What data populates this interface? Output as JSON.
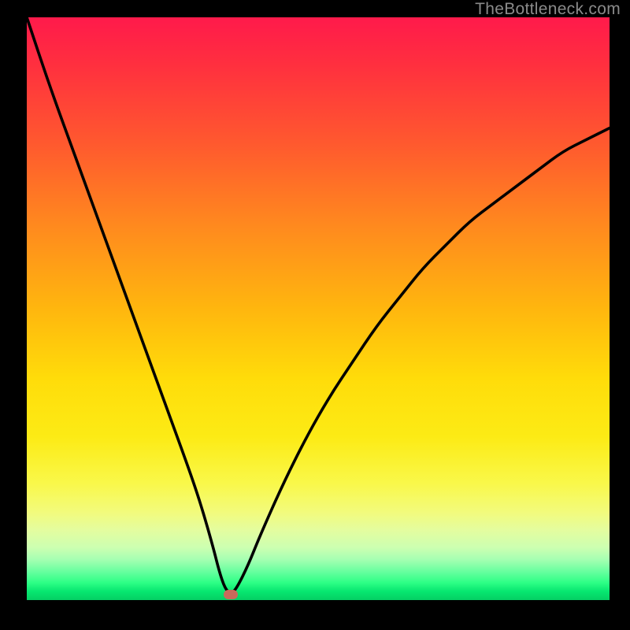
{
  "watermark": "TheBottleneck.com",
  "colors": {
    "curve_stroke": "#000000",
    "marker_fill": "#c96a5b",
    "frame_bg": "#000000"
  },
  "chart_data": {
    "type": "line",
    "title": "",
    "xlabel": "",
    "ylabel": "",
    "xlim": [
      0,
      100
    ],
    "ylim": [
      0,
      100
    ],
    "grid": false,
    "legend": false,
    "series": [
      {
        "name": "bottleneck-curve",
        "x": [
          0,
          4,
          8,
          12,
          16,
          20,
          24,
          28,
          30,
          32,
          33,
          34,
          35,
          36,
          38,
          40,
          44,
          48,
          52,
          56,
          60,
          64,
          68,
          72,
          76,
          80,
          84,
          88,
          92,
          96,
          100
        ],
        "y": [
          100,
          88,
          77,
          66,
          55,
          44,
          33,
          22,
          16,
          9,
          5,
          2,
          1,
          2,
          6,
          11,
          20,
          28,
          35,
          41,
          47,
          52,
          57,
          61,
          65,
          68,
          71,
          74,
          77,
          79,
          81
        ]
      }
    ],
    "marker": {
      "x": 35,
      "y": 1
    },
    "notch_x": 35
  }
}
